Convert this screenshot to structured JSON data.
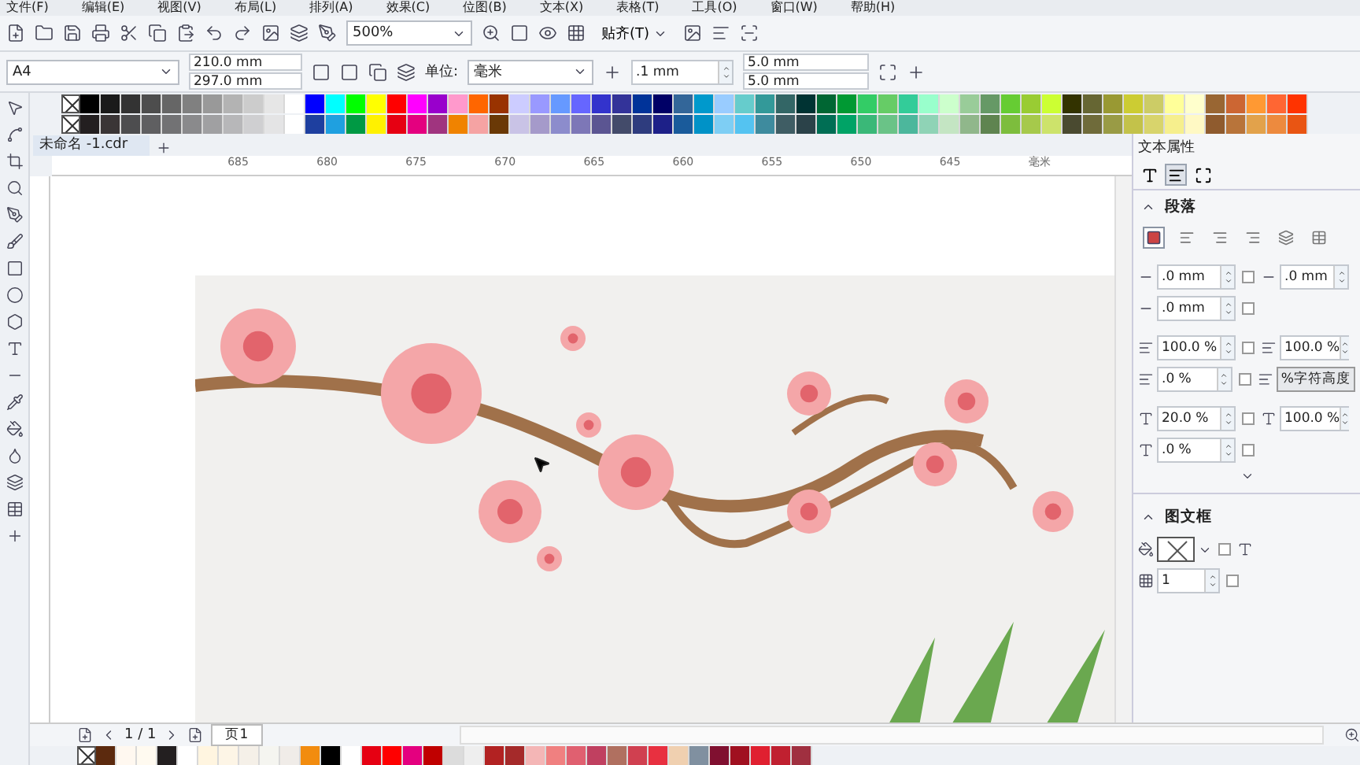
{
  "menu_bar": [
    "文件(F)",
    "编辑(E)",
    "视图(V)",
    "布局(L)",
    "排列(A)",
    "效果(C)",
    "位图(B)",
    "文本(X)",
    "表格(T)",
    "工具(O)",
    "窗口(W)",
    "帮助(H)"
  ],
  "toolbar": {
    "zoom": "500%",
    "snap_button": "贴齐(T)"
  },
  "property_bar": {
    "page_size": "A4",
    "width": "210.0 mm",
    "height": "297.0 mm",
    "unit_label": "单位:",
    "unit": "毫米",
    "nudge": ".1 mm",
    "duplicate_x": "5.0 mm",
    "duplicate_y": "5.0 mm"
  },
  "document_tab": "未命名 -1.cdr",
  "ruler": {
    "labels": [
      "685",
      "680",
      "675",
      "670",
      "665",
      "660",
      "655",
      "650",
      "645"
    ],
    "unit": "毫米"
  },
  "text_properties": {
    "title": "文本属性",
    "tabs": [
      {
        "kind": "character",
        "selected": false
      },
      {
        "kind": "paragraph",
        "selected": true
      },
      {
        "kind": "frame",
        "selected": false
      }
    ],
    "paragraph": {
      "title": "段落",
      "expanded": true,
      "alignment": [
        {
          "kind": "none",
          "selected": true
        },
        {
          "kind": "left",
          "selected": false
        },
        {
          "kind": "center",
          "selected": false
        },
        {
          "kind": "right",
          "selected": false
        },
        {
          "kind": "full",
          "selected": false
        },
        {
          "kind": "force",
          "selected": false
        }
      ],
      "rows": [
        {
          "checked": false,
          "items": [
            {
              "kind": "spin",
              "value": ".0 mm"
            },
            {
              "kind": "spin",
              "value": ".0 mm"
            }
          ]
        },
        {
          "checked": false,
          "items": [
            {
              "kind": "spin",
              "value": ".0 mm"
            }
          ]
        },
        {
          "checked": false,
          "items": [
            {
              "kind": "spin",
              "value": "100.0 %"
            },
            {
              "kind": "spin",
              "value": "100.0 %"
            }
          ]
        },
        {
          "checked": false,
          "items": [
            {
              "kind": "spin",
              "value": ".0 %"
            },
            {
              "kind": "dropdown",
              "value": "%字符高度"
            }
          ]
        },
        {
          "checked": false,
          "items": [
            {
              "kind": "spin",
              "value": "20.0 %"
            },
            {
              "kind": "spin",
              "value": "100.0 %"
            }
          ]
        },
        {
          "checked": false,
          "items": [
            {
              "kind": "spin",
              "value": ".0 %"
            }
          ]
        }
      ]
    },
    "frame": {
      "title": "图文框",
      "expanded": true,
      "background_checked": false,
      "columns": "1",
      "columns_checked": false
    }
  },
  "page_nav": {
    "counter": "1 / 1",
    "page_tab": "页1"
  }
}
